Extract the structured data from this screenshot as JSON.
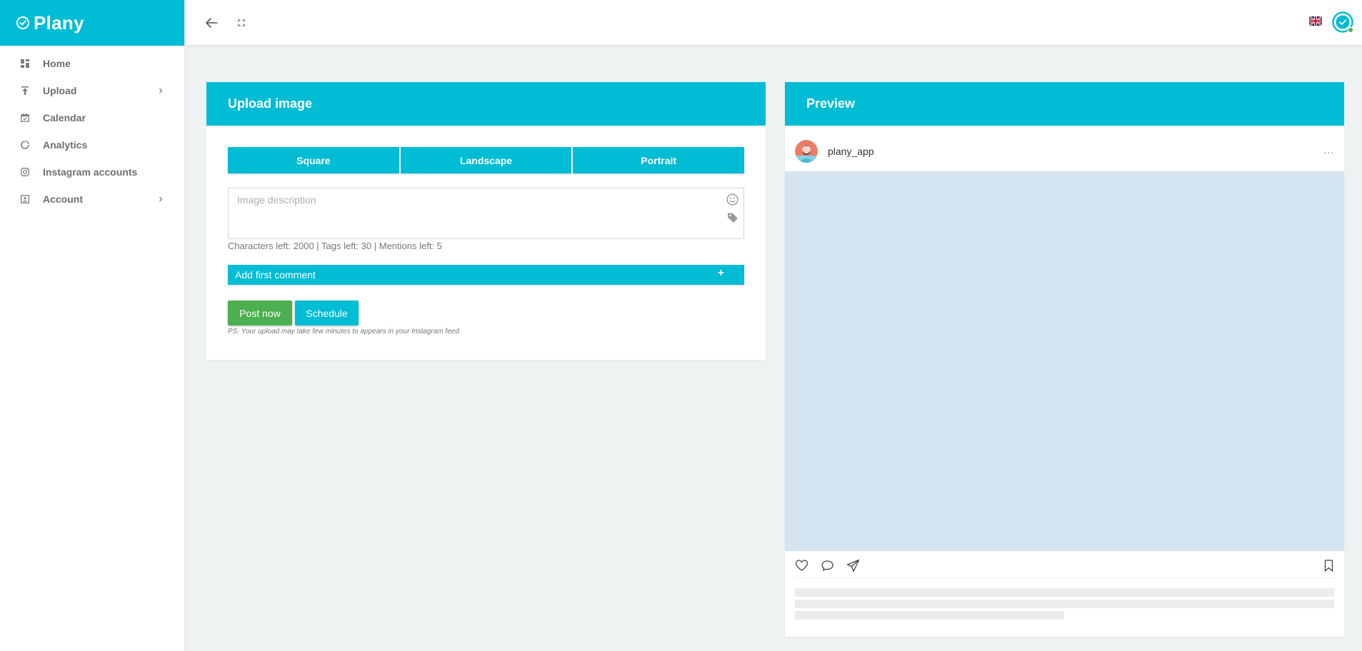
{
  "app": {
    "name": "Plany"
  },
  "sidebar": {
    "items": [
      {
        "label": "Home",
        "icon": "dashboard-icon",
        "has_submenu": false
      },
      {
        "label": "Upload",
        "icon": "upload-icon",
        "has_submenu": true
      },
      {
        "label": "Calendar",
        "icon": "calendar-icon",
        "has_submenu": false
      },
      {
        "label": "Analytics",
        "icon": "analytics-icon",
        "has_submenu": false
      },
      {
        "label": "Instagram accounts",
        "icon": "instagram-icon",
        "has_submenu": false
      },
      {
        "label": "Account",
        "icon": "account-icon",
        "has_submenu": true
      }
    ]
  },
  "topbar": {
    "language_icon": "uk-flag-icon",
    "user_icon": "user-status-icon"
  },
  "upload": {
    "title": "Upload image",
    "formats": [
      "Square",
      "Landscape",
      "Portrait"
    ],
    "description_placeholder": "Image description",
    "counter": "Characters left: 2000 | Tags left: 30 | Mentions left: 5",
    "add_comment_label": "Add first comment",
    "add_comment_icon": "+",
    "post_now_label": "Post now",
    "schedule_label": "Schedule",
    "note": "PS: Your upload may take few minutes to appears in your Instagram feed."
  },
  "preview": {
    "title": "Preview",
    "username": "plany_app",
    "more_icon": "..."
  },
  "colors": {
    "accent": "#00bcd4",
    "success": "#4caf50",
    "image_placeholder": "#d4e4f0",
    "background": "#eef2f3"
  }
}
